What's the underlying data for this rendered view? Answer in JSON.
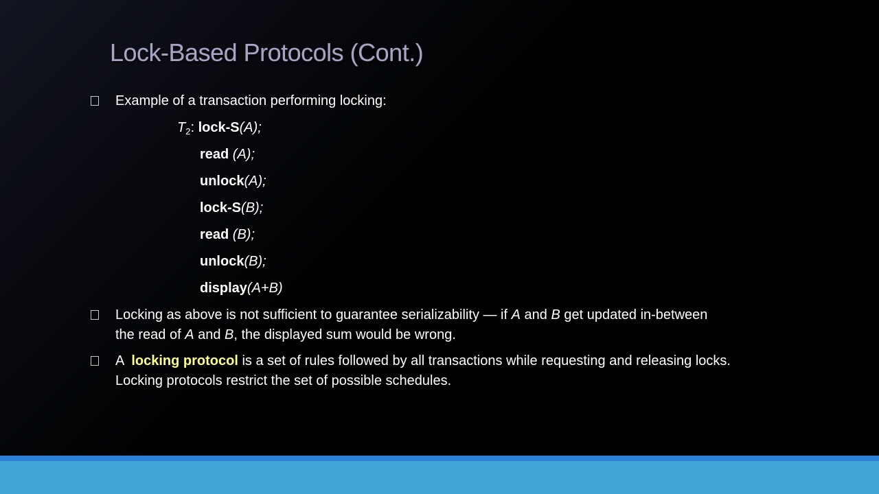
{
  "slide": {
    "title": "Lock-Based Protocols (Cont.)",
    "bullet1": {
      "text": "Example of a transaction performing locking:"
    },
    "code": {
      "t_letter": "T",
      "t_sub": "2",
      "colon": ": ",
      "lines": [
        {
          "kw": "lock-S",
          "arg": "(A)",
          "end": ";"
        },
        {
          "kw": "read",
          "arg": " (A)",
          "end": ";"
        },
        {
          "kw": "unlock",
          "arg": "(A)",
          "end": ";"
        },
        {
          "kw": "lock-S",
          "arg": "(B)",
          "end": ";"
        },
        {
          "kw": "read",
          "arg": " (B)",
          "end": ";"
        },
        {
          "kw": "unlock",
          "arg": "(B)",
          "end": ";"
        },
        {
          "kw": "display",
          "arg": "(A+B)",
          "end": ""
        }
      ]
    },
    "bullet2": {
      "p1": "Locking as above is not sufficient to guarantee serializability — if ",
      "a": "A",
      "p2": " and ",
      "b": "B",
      "p3": " get updated in-between",
      "p4": "the read of ",
      "a2": "A",
      "p5": " and ",
      "b2": "B",
      "p6": ", the displayed sum would be wrong."
    },
    "bullet3": {
      "p1": "A  ",
      "term": "locking protocol",
      "p2": " is a set of rules followed by all transactions while requesting and releasing locks.",
      "line2": "Locking protocols restrict the set of possible schedules."
    }
  },
  "colors": {
    "title": "#a8a4c4",
    "highlight": "#ffff8c",
    "footer_band": "#2f80d8",
    "footer_bar": "#40a4d4"
  }
}
